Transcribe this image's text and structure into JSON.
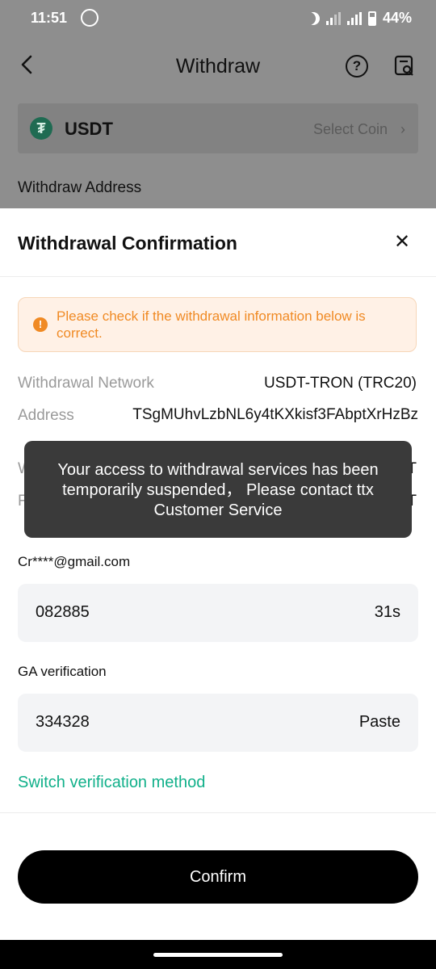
{
  "status_bar": {
    "time": "11:51",
    "network": "4G",
    "battery": "44%",
    "icons": [
      "whatsapp-icon",
      "moon-icon",
      "signal-icon",
      "signal-4g-icon",
      "battery-icon"
    ]
  },
  "header": {
    "title": "Withdraw",
    "back_icon": "chevron-left-icon",
    "help_icon": "question-circle-icon",
    "record_icon": "document-search-icon"
  },
  "coin_selector": {
    "coin": "USDT",
    "select_label": "Select Coin"
  },
  "withdraw_address_label": "Withdraw Address",
  "sheet": {
    "title": "Withdrawal Confirmation",
    "warning": "Please check if the withdrawal information below is correct.",
    "network_label": "Withdrawal Network",
    "network_value": "USDT-TRON (TRC20)",
    "address_label": "Address",
    "address_value": "TSgMUhvLzbNL6y4tKXkisf3FAbptXrHzBz",
    "partial_row1_label": "W",
    "partial_row1_value": "T",
    "partial_row2_label": "F",
    "partial_row2_value": "T",
    "email_label": "Cr****@gmail.com",
    "email_code": "082885",
    "email_countdown": "31s",
    "ga_label": "GA verification",
    "ga_code": "334328",
    "paste_label": "Paste",
    "switch_method": "Switch verification method",
    "confirm_label": "Confirm"
  },
  "toast": {
    "message": "Your access to withdrawal services has been temporarily suspended， Please contact ttx Customer Service"
  },
  "colors": {
    "accent_green": "#11b08a",
    "warning_orange": "#f08a24",
    "overlay_gray": "#8e8e8e",
    "button_black": "#000000"
  }
}
